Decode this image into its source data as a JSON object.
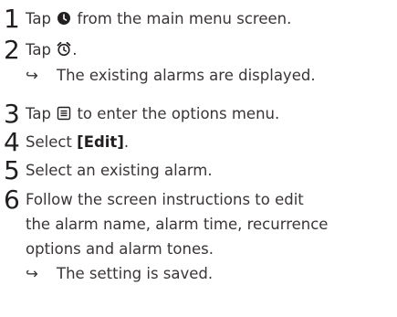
{
  "steps": [
    {
      "number": "1",
      "before": "Tap",
      "after": "from the main menu screen.",
      "icon": "alarm-app-icon"
    },
    {
      "number": "2",
      "before": "Tap",
      "after": ".",
      "icon": "alarm-clock-icon",
      "result": "The existing alarms are displayed."
    },
    {
      "number": "3",
      "before": "Tap",
      "after": "to enter the options menu.",
      "icon": "options-menu-icon"
    },
    {
      "number": "4",
      "before": "Select",
      "bold": "[Edit]",
      "after": "."
    },
    {
      "number": "5",
      "text": "Select an existing alarm."
    },
    {
      "number": "6",
      "lines": [
        "Follow the screen instructions to edit",
        "the alarm name, alarm time, recurrence",
        "options and alarm tones."
      ],
      "result": "The setting is saved."
    }
  ],
  "arrow_glyph": "↪"
}
